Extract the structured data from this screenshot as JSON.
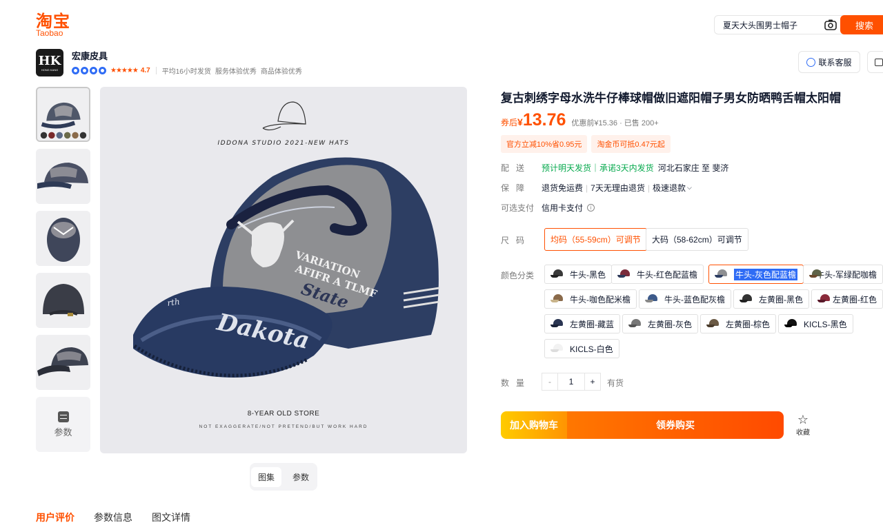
{
  "header": {
    "logo_cn": "淘宝",
    "logo_en": "Taobao",
    "search_value": "夏天大头围男士帽子",
    "search_button": "搜索",
    "brand_color": "#ff5000"
  },
  "shop": {
    "logo_text": "HK",
    "logo_subtext": "HONG KANG",
    "name": "宏康皮具",
    "rating": "4.7",
    "meta": [
      "平均16小时发货",
      "服务体验优秀",
      "商品体验优秀"
    ],
    "contact_button": "联系客服"
  },
  "gallery": {
    "thumb_count": 5,
    "params_label": "参数",
    "brand_line": "IDDONA STUDIO 2021-NEW HATS",
    "store_line": "8-YEAR OLD STORE",
    "slogan_line": "NOT EXAGGERATE/NOT PRETEND/BUT WORK HARD",
    "view_tabs": [
      "图集",
      "参数"
    ]
  },
  "product": {
    "title": "复古刺绣字母水洗牛仔棒球帽做旧遮阳帽子男女防晒鸭舌帽太阳帽",
    "price_prefix": "券后",
    "currency": "¥",
    "price": "13.76",
    "orig_price": "优惠前¥15.36 · 已售 200+",
    "coupons": [
      "官方立减10%省0.95元",
      "淘金币可抵0.47元起"
    ],
    "delivery": {
      "label": "配送",
      "promise": "预计明天发货｜承诺3天内发货",
      "route": "河北石家庄 至 斐济"
    },
    "guarantee": {
      "label": "保障",
      "items": [
        "退货免运费",
        "7天无理由退货",
        "极速退款"
      ]
    },
    "payment": {
      "label": "可选支付",
      "value": "信用卡支付"
    },
    "size": {
      "label": "尺码",
      "options": [
        "均码（55-59cm）可调节",
        "大码（58-62cm）可调节"
      ],
      "selected": 0
    },
    "color": {
      "label": "颜色分类",
      "options": [
        "牛头-黑色",
        "牛头-红色配蓝檐",
        "牛头-灰色配蓝檐",
        "牛头-军绿配咖檐",
        "牛头-咖色配米檐",
        "牛头-蓝色配灰檐",
        "左黄圈-黑色",
        "左黄圈-红色",
        "左黄圈-藏蓝",
        "左黄圈-灰色",
        "左黄圈-棕色",
        "KICLS-黑色",
        "KICLS-白色"
      ],
      "selected": 2
    },
    "quantity": {
      "label": "数量",
      "value": "1",
      "minus": "-",
      "plus": "+",
      "stock": "有货"
    },
    "buttons": {
      "cart": "加入购物车",
      "buy": "领券购买",
      "favorite": "收藏"
    }
  },
  "bottom_tabs": [
    "用户评价",
    "参数信息",
    "图文详情"
  ]
}
